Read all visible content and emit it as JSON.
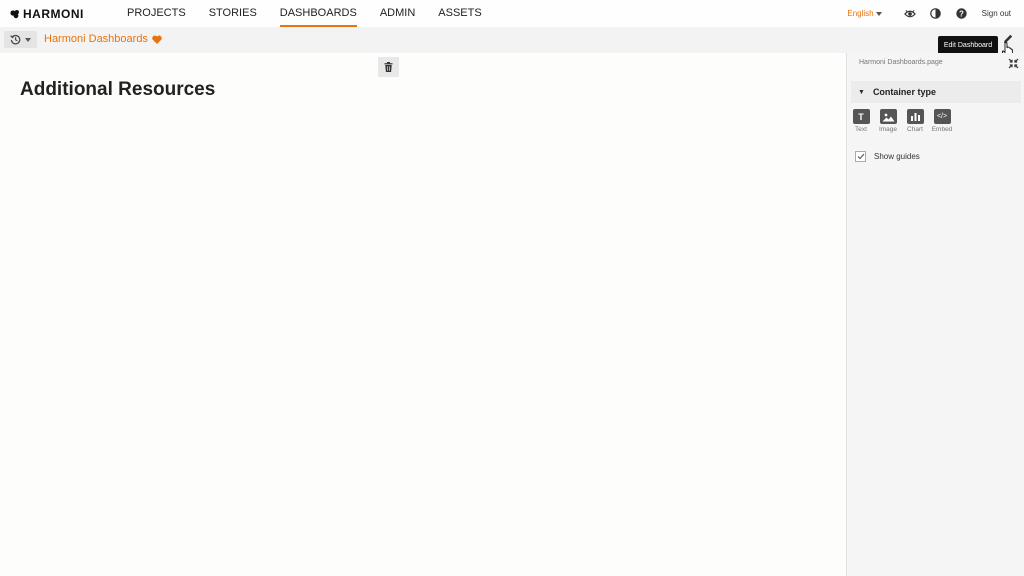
{
  "app": {
    "logo": "HARMONI"
  },
  "nav": {
    "items": [
      "PROJECTS",
      "STORIES",
      "DASHBOARDS",
      "ADMIN",
      "ASSETS"
    ],
    "active": "DASHBOARDS"
  },
  "top_right": {
    "language": "English",
    "sign_out": "Sign out"
  },
  "toolbar": {
    "breadcrumb": "Harmoni Dashboards",
    "tooltip": "Edit Dashboard"
  },
  "canvas": {
    "heading": "Additional Resources"
  },
  "panel": {
    "path": "Harmoni Dashboards.page",
    "section_title": "Container type",
    "container_types": [
      {
        "label": "Text",
        "glyph": "T"
      },
      {
        "label": "Image"
      },
      {
        "label": "Chart"
      },
      {
        "label": "Embed",
        "glyph": "</>"
      }
    ],
    "show_guides": "Show guides",
    "show_guides_checked": true
  },
  "colors": {
    "accent": "#e8730f",
    "icon_dark": "#555555"
  }
}
